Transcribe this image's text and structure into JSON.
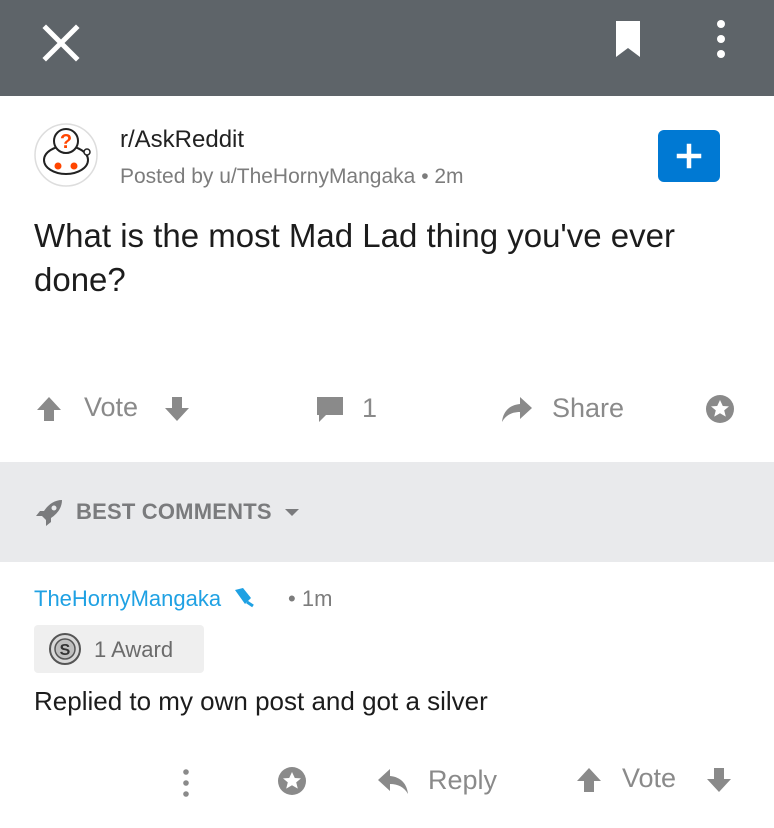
{
  "toolbar": {
    "close_icon": "close-icon",
    "save_icon": "bookmark-icon",
    "more_icon": "kebab-menu-icon",
    "background": "#5e6469"
  },
  "post": {
    "subreddit": "r/AskReddit",
    "posted_by": "Posted by u/TheHornyMangaka",
    "age": "2m",
    "join_icon": "plus-icon",
    "join_color": "#0079d3",
    "title": "What is the most Mad Lad thing you've ever done?",
    "vote_label": "Vote",
    "comment_count": "1",
    "share_label": "Share"
  },
  "sort": {
    "label": "BEST COMMENTS",
    "icon": "rocket-icon"
  },
  "comment": {
    "author": "TheHornyMangaka",
    "author_color": "#1fa1e3",
    "op_icon": "microphone-icon",
    "age": "1m",
    "award_label": "1 Award",
    "award_icon": "silver-award-icon",
    "body": "Replied to my own post and got a silver",
    "reply_label": "Reply",
    "vote_label": "Vote"
  }
}
